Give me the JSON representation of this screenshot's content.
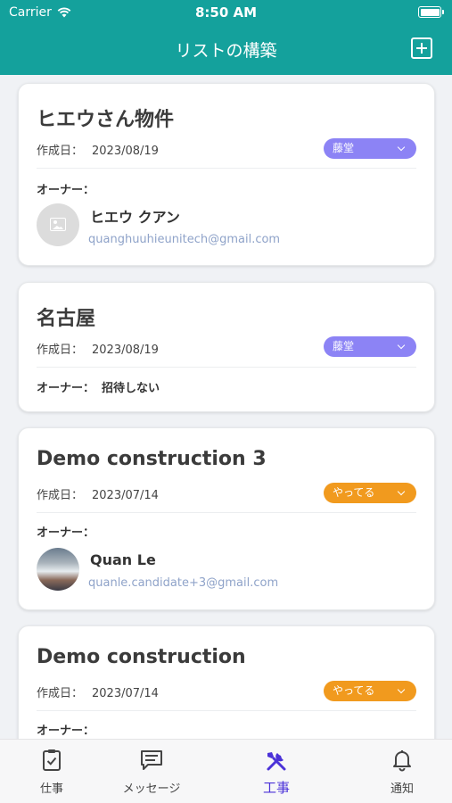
{
  "status_bar": {
    "carrier": "Carrier",
    "time": "8:50 AM"
  },
  "header": {
    "title": "リストの構築"
  },
  "created_label": "作成日：",
  "owner_label": "オーナー：",
  "cards": [
    {
      "title": "ヒエウさん物件",
      "date": "2023/08/19",
      "status": "藤堂",
      "status_color": "#8c83f5",
      "owner_name": "ヒエウ クアン",
      "owner_email": "quanghuuhieunitech@gmail.com"
    },
    {
      "title": "名古屋",
      "date": "2023/08/19",
      "status": "藤堂",
      "status_color": "#8c83f5",
      "owner_inline": "招待しない"
    },
    {
      "title": "Demo construction 3",
      "date": "2023/07/14",
      "status": "やってる",
      "status_color": "#f19a1e",
      "owner_name": "Quan Le",
      "owner_email": "quanle.candidate+3@gmail.com"
    },
    {
      "title": "Demo construction",
      "date": "2023/07/14",
      "status": "やってる",
      "status_color": "#f19a1e"
    }
  ],
  "tabs": [
    {
      "label": "仕事",
      "icon": "task-check-icon"
    },
    {
      "label": "メッセージ",
      "icon": "message-icon"
    },
    {
      "label": "工事",
      "icon": "tools-icon"
    },
    {
      "label": "通知",
      "icon": "bell-icon"
    }
  ],
  "colors": {
    "primary": "#14a19c",
    "active_tab": "#4b32d8",
    "email": "#8fa3c9"
  }
}
